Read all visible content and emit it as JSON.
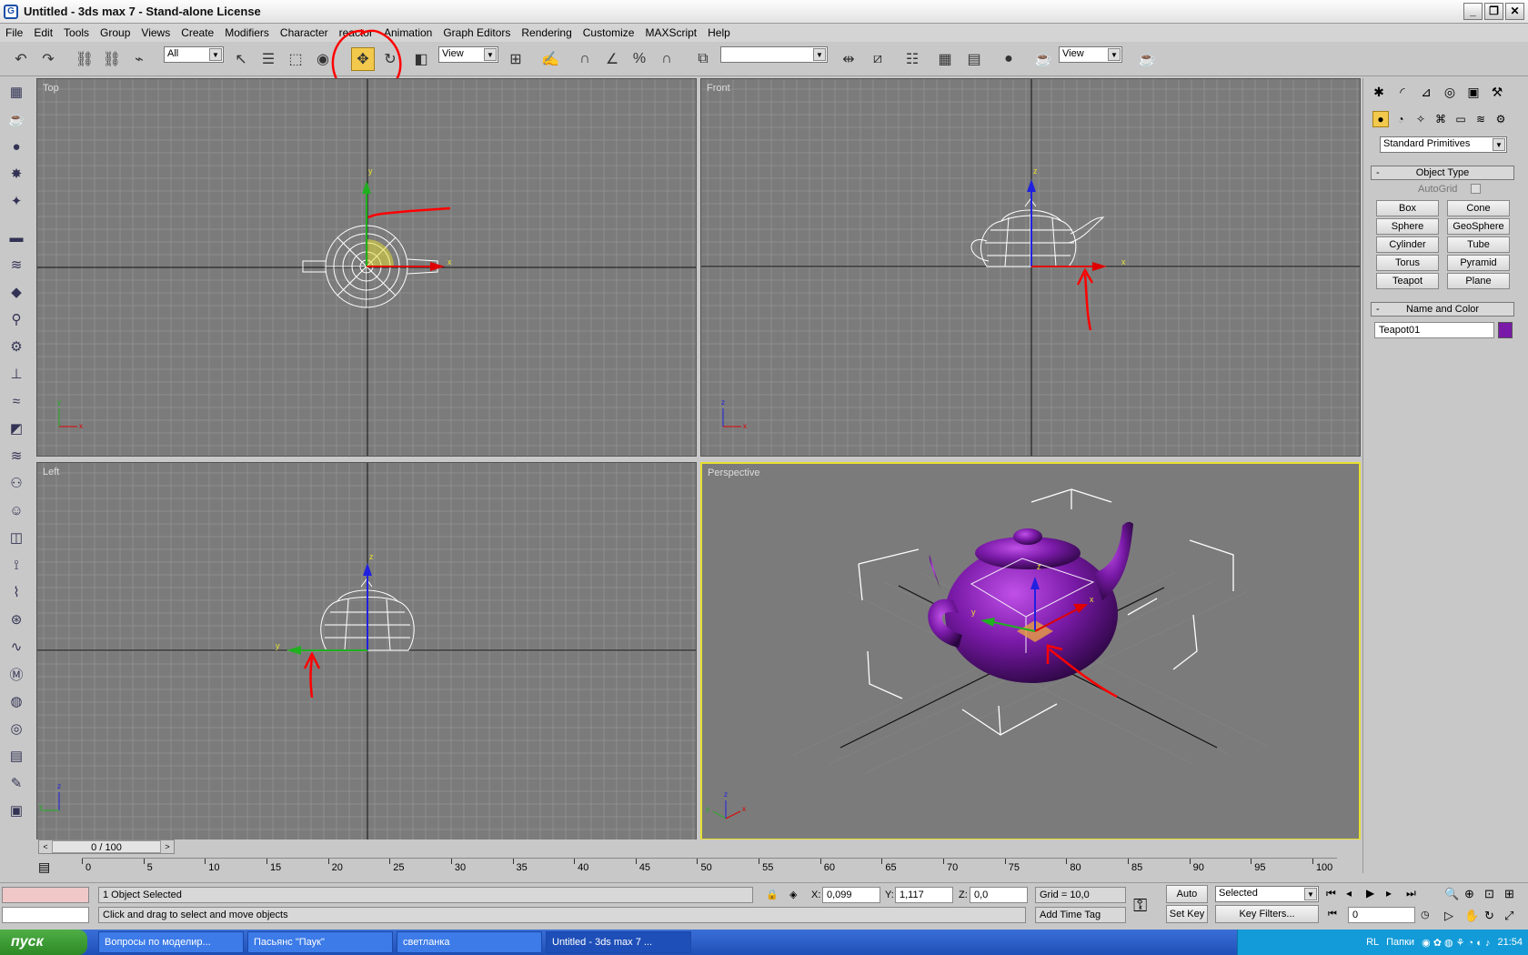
{
  "window": {
    "title": "Untitled - 3ds max 7  - Stand-alone License",
    "min": "_",
    "restore": "❐",
    "close": "✕"
  },
  "menu": [
    "File",
    "Edit",
    "Tools",
    "Group",
    "Views",
    "Create",
    "Modifiers",
    "Character",
    "reactor",
    "Animation",
    "Graph Editors",
    "Rendering",
    "Customize",
    "MAXScript",
    "Help"
  ],
  "toolbar": {
    "selection_filter": "All",
    "ref_coord": "View",
    "named_set": "",
    "render_type": "View"
  },
  "viewports": {
    "top": "Top",
    "front": "Front",
    "left": "Left",
    "perspective": "Perspective"
  },
  "gizmo_labels": {
    "x": "x",
    "y": "y",
    "z": "z"
  },
  "command_panel": {
    "category": "Standard Primitives",
    "object_type": {
      "title": "Object Type",
      "toggle": "-",
      "autogrid": "AutoGrid",
      "buttons": [
        "Box",
        "Cone",
        "Sphere",
        "GeoSphere",
        "Cylinder",
        "Tube",
        "Torus",
        "Pyramid",
        "Teapot",
        "Plane"
      ]
    },
    "name_color": {
      "title": "Name and Color",
      "toggle": "-",
      "name": "Teapot01",
      "color": "#7a1aa8"
    }
  },
  "timeslider": {
    "label": "0 / 100",
    "ticks": [
      "0",
      "5",
      "10",
      "15",
      "20",
      "25",
      "30",
      "35",
      "40",
      "45",
      "50",
      "55",
      "60",
      "65",
      "70",
      "75",
      "80",
      "85",
      "90",
      "95",
      "100"
    ]
  },
  "status": {
    "selected": "1 Object Selected",
    "prompt": "Click and drag to select and move objects",
    "x_label": "X:",
    "x": "0,099",
    "y_label": "Y:",
    "y": "1,117",
    "z_label": "Z:",
    "z": "0,0",
    "grid": "Grid = 10,0",
    "add_time_tag": "Add Time Tag",
    "auto_key": "Auto Key",
    "set_key": "Set Key",
    "key_mode": "Selected",
    "key_filters": "Key Filters...",
    "frame": "0"
  },
  "taskbar": {
    "start": "пуск",
    "tasks": [
      "Вопросы по моделир...",
      "Пасьянс \"Паук\"",
      "светланка",
      "Untitled - 3ds max 7  ..."
    ],
    "lang": "RL",
    "folder": "Папки",
    "clock": "21:54"
  },
  "colors": {
    "accent": "#f2c94c",
    "teapot": "#7a1aa8",
    "grid_bg": "#7b7b7b",
    "active_border": "#e8e030",
    "annotation": "#ff0000"
  }
}
